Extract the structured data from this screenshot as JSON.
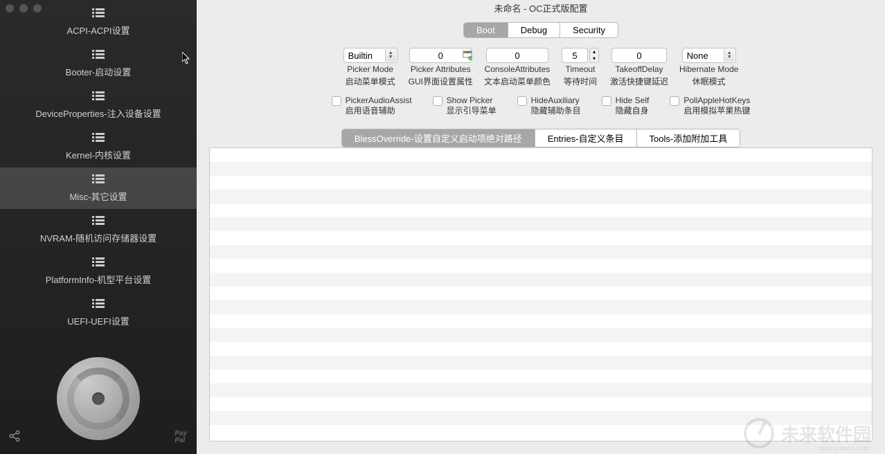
{
  "window": {
    "title": "未命名 - OC正式版配置"
  },
  "sidebar": {
    "items": [
      {
        "label": "ACPI-ACPI设置"
      },
      {
        "label": "Booter-启动设置"
      },
      {
        "label": "DeviceProperties-注入设备设置"
      },
      {
        "label": "Kernel-内核设置"
      },
      {
        "label": "Misc-其它设置"
      },
      {
        "label": "NVRAM-随机访问存储器设置"
      },
      {
        "label": "PlatformInfo-机型平台设置"
      },
      {
        "label": "UEFI-UEFI设置"
      }
    ],
    "paypal": "Pay\nPal"
  },
  "topTabs": {
    "boot": "Boot",
    "debug": "Debug",
    "security": "Security"
  },
  "fields": {
    "pickerMode": {
      "value": "Builtin",
      "label": "Picker Mode",
      "sublabel": "启动菜单模式"
    },
    "pickerAttributes": {
      "value": "0",
      "label": "Picker Attributes",
      "sublabel": "GUI界面设置属性"
    },
    "consoleAttributes": {
      "value": "0",
      "label": "ConsoleAttributes",
      "sublabel": "文本启动菜单颜色"
    },
    "timeout": {
      "value": "5",
      "label": "Timeout",
      "sublabel": "等待时间"
    },
    "takeoffDelay": {
      "value": "0",
      "label": "TakeoffDelay",
      "sublabel": "激活快捷键延迟"
    },
    "hibernateMode": {
      "value": "None",
      "label": "Hibernate Mode",
      "sublabel": "休眠模式"
    }
  },
  "checkboxes": {
    "pickerAudioAssist": {
      "label": "PickerAudioAssist",
      "sublabel": "启用语音辅助"
    },
    "showPicker": {
      "label": "Show Picker",
      "sublabel": "显示引导菜单"
    },
    "hideAuxiliary": {
      "label": "HideAuxiliary",
      "sublabel": "隐藏辅助条目"
    },
    "hideSelf": {
      "label": "Hide Self",
      "sublabel": "隐藏自身"
    },
    "pollAppleHotKeys": {
      "label": "PollAppleHotKeys",
      "sublabel": "启用模拟苹果热键"
    }
  },
  "subTabs": {
    "blessOverride": "BlessOverride-设置自定义启动项绝对路径",
    "entries": "Entries-自定义条目",
    "tools": "Tools-添加附加工具"
  },
  "watermark": {
    "text": "未来软件园",
    "sub": "mac.orsoon.com"
  }
}
